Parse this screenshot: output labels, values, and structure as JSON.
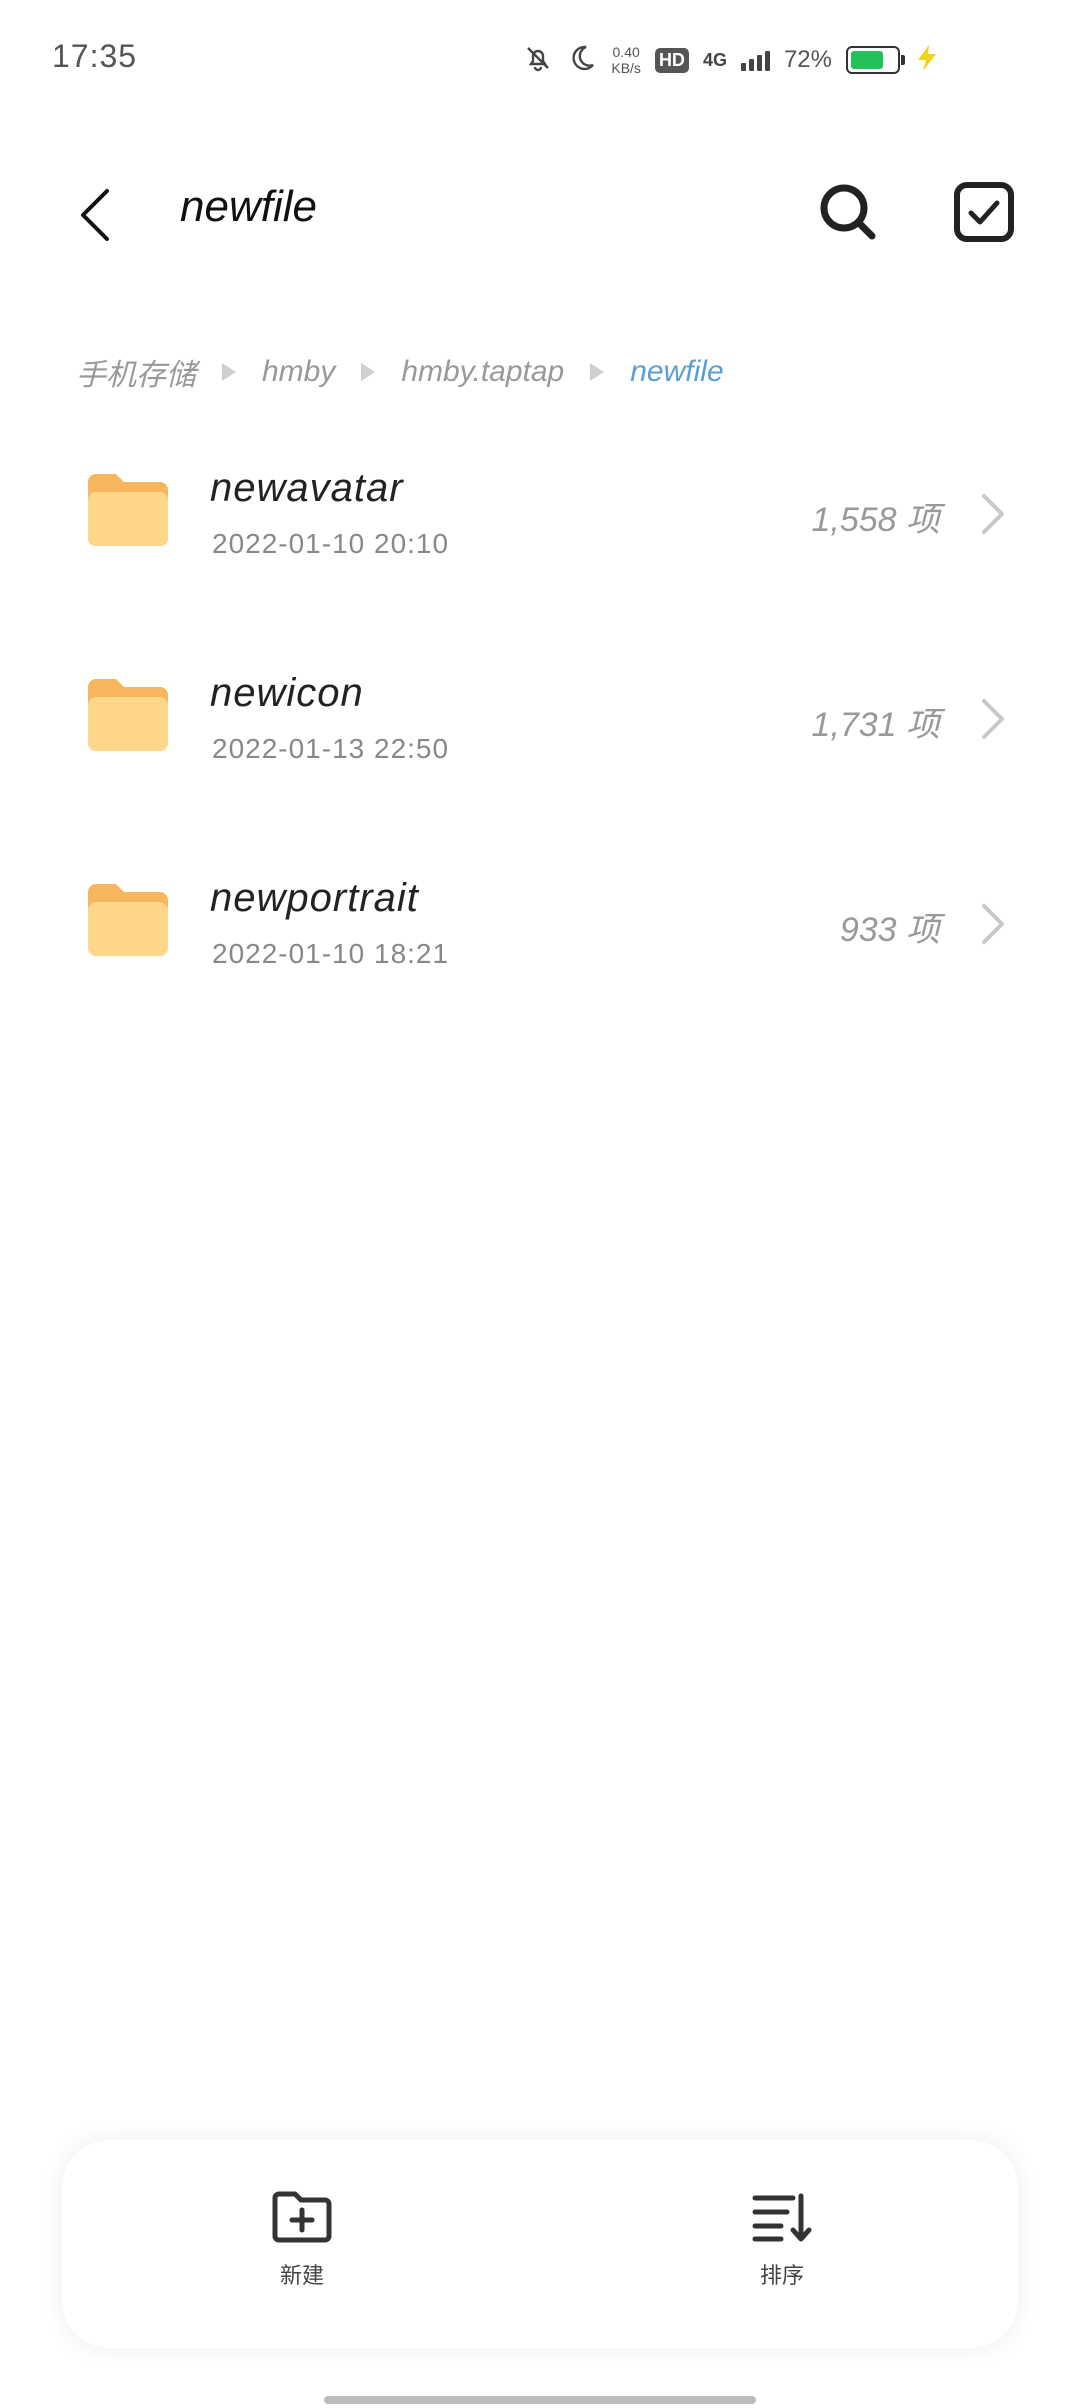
{
  "status_bar": {
    "time": "17:35",
    "net_speed_value": "0.40",
    "net_speed_unit": "KB/s",
    "hd_label": "HD",
    "network_type": "4G",
    "battery_percent": "72%",
    "battery_level": 0.72,
    "battery_color": "#22c15a",
    "icons": [
      "bell-off-icon",
      "moon-icon",
      "signal-icon",
      "battery-icon",
      "charging-bolt-icon"
    ]
  },
  "header": {
    "title": "newfile",
    "icons": [
      "back-arrow-icon",
      "search-icon",
      "select-check-icon"
    ]
  },
  "breadcrumb": {
    "items": [
      "手机存储",
      "hmby",
      "hmby.taptap",
      "newfile"
    ],
    "current_color": "#5a9ed6"
  },
  "files": [
    {
      "name": "newavatar",
      "date": "2022-01-10 20:10",
      "count": "1,558 项"
    },
    {
      "name": "newicon",
      "date": "2022-01-13 22:50",
      "count": "1,731 项"
    },
    {
      "name": "newportrait",
      "date": "2022-01-10 18:21",
      "count": "933 项"
    }
  ],
  "folder_color": "#ffd68a",
  "toolbar": {
    "new_label": "新建",
    "sort_label": "排序"
  }
}
